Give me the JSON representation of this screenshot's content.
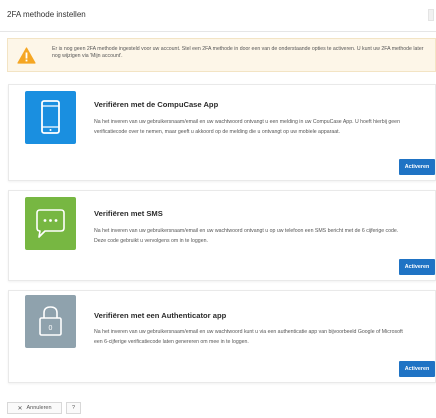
{
  "header": {
    "title": "2FA methode instellen"
  },
  "alert": {
    "icon": "warning-icon",
    "message": "Er is nog geen 2FA methode ingesteld voor uw account. Stel een 2FA methode in door een van de onderstaande opties te activeren. U kunt uw 2FA methode later nog wijzigen via 'Mijn account'."
  },
  "methods": [
    {
      "icon": "phone-icon",
      "color": "#1a8fe0",
      "title": "Verifiëren met de CompuCase App",
      "description": "Na het inveren van uw gebruikersnaam/email en uw wachtwoord ontvangt u een melding in uw CompuCase App. U hoeft hierbij geen verificatiecode over te nemen, maar geeft u akkoord op de melding die u ontvangt op uw mobiele apparaat.",
      "button": "Activeren"
    },
    {
      "icon": "chat-bubble-icon",
      "color": "#77b742",
      "title": "Verifiëren met SMS",
      "description": "Na het inveren van uw gebruikersnaam/email en uw wachtwoord ontvangt u op uw telefoon een SMS bericht met de 6 cijferige code. Deze code gebruikt u vervolgens om in te loggen.",
      "button": "Activeren"
    },
    {
      "icon": "lock-icon",
      "color": "#8fa2ad",
      "title": "Verifiëren met een Authenticator app",
      "description": "Na het inveren van uw gebruikersnaam/email en uw wachtwoord kunt u via een authenticatie app van bijvoorbeeld Google of Microsoft een 6-cijferige verificatiecode laten genereren om mee in te loggen.",
      "button": "Activeren"
    }
  ],
  "footer": {
    "cancel_label": "Annuleren",
    "cancel_icon": "close-icon",
    "help_label": "?"
  },
  "colors": {
    "primary_button": "#1f73c4",
    "warning": "#f5a623"
  }
}
